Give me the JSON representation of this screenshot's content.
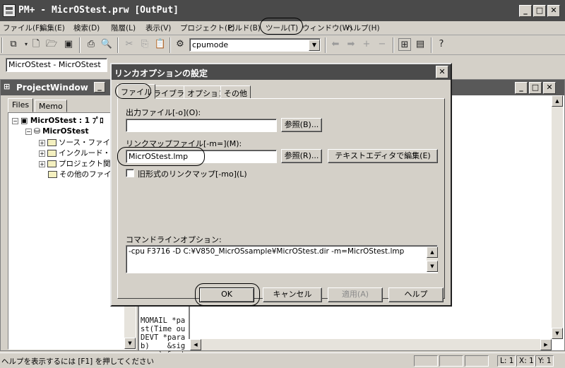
{
  "window": {
    "title": "PM+ - MicrOStest.prw [OutPut]"
  },
  "menu": [
    "ファイル(F)",
    "編集(E)",
    "検索(D)",
    "階層(L)",
    "表示(V)",
    "プロジェクト(P)",
    "ビルド(B)",
    "ツール(T)",
    "ウィンドウ(W)",
    "ヘルプ(H)"
  ],
  "toolbar": {
    "cpu_combo": "cpumode"
  },
  "project_combo": "MicrOStest - MicrOStest",
  "project_window": {
    "title": "ProjectWindow",
    "tabs": [
      "Files",
      "Memo"
    ],
    "tree": [
      "MicrOStest : 1 ﾌﾟﾛ",
      "MicrOStest",
      "ソース・ファイル",
      "インクルード・ファイ",
      "プロジェクト関連",
      "その他のファイル"
    ]
  },
  "output": {
    "lines": [
      "MOMAIL *pa",
      "st(Time ou",
      "DEVT *para",
      "b)    &sig",
      "aram) &__t"
    ]
  },
  "dialog": {
    "title": "リンカオプションの設定",
    "tabs": [
      "ファイル",
      "ライブラリ",
      "オプション",
      "その他"
    ],
    "output_file_label": "出力ファイル[-o](O):",
    "output_file_value": "",
    "browse1": "参照(B)...",
    "linkmap_label": "リンクマップファイル[-m=](M):",
    "linkmap_value": "MicrOStest.lmp",
    "browse2": "参照(R)...",
    "text_editor": "テキストエディタで編集(E)",
    "old_format_label": "旧形式のリンクマップ[-mo](L)",
    "cmdline_label": "コマンドラインオプション:",
    "cmdline_value": "-cpu F3716 -D C:¥V850_MicrOSsample¥MicrOStest.dir -m=MicrOStest.lmp",
    "ok": "OK",
    "cancel": "キャンセル",
    "apply": "適用(A)",
    "help": "ヘルプ"
  },
  "status": {
    "text": "ヘルプを表示するには [F1] を押してください",
    "line": "L: 1",
    "col": "X: 1",
    "y": "Y: 1"
  }
}
